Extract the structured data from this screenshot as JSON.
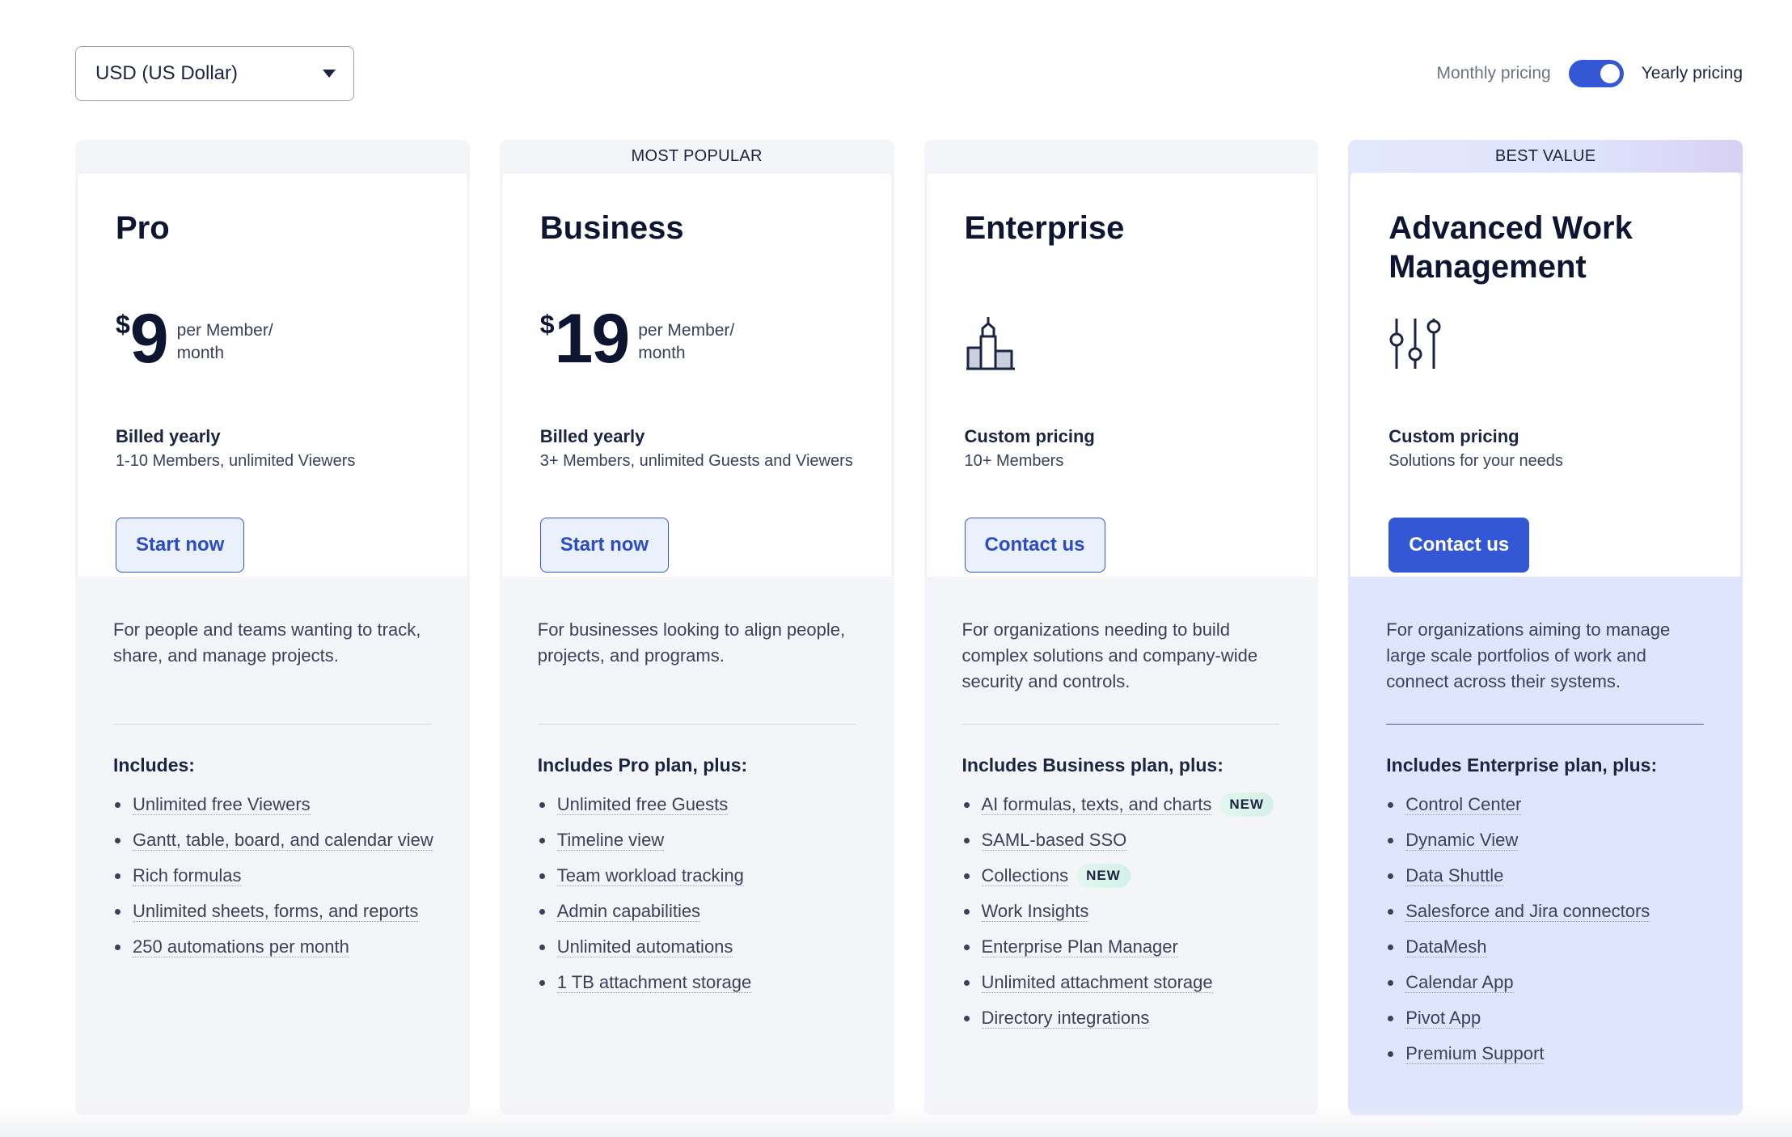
{
  "currency_select": {
    "value": "USD (US Dollar)"
  },
  "billing_toggle": {
    "monthly_label": "Monthly pricing",
    "yearly_label": "Yearly pricing",
    "selected": "Yearly pricing"
  },
  "plans": [
    {
      "banner": "",
      "name": "Pro",
      "price": {
        "currency_symbol": "$",
        "amount": "9",
        "unit": "per Member/ month"
      },
      "billing": "Billed yearly",
      "billing_sub": "1-10 Members, unlimited Viewers",
      "cta": "Start now",
      "description": "For people and teams wanting to track, share, and manage projects.",
      "includes_title": "Includes:",
      "features": [
        {
          "text": "Unlimited free Viewers",
          "badge": ""
        },
        {
          "text": "Gantt, table, board, and calendar view",
          "badge": ""
        },
        {
          "text": "Rich formulas",
          "badge": ""
        },
        {
          "text": "Unlimited sheets, forms, and reports",
          "badge": ""
        },
        {
          "text": "250 automations per month",
          "badge": ""
        }
      ]
    },
    {
      "banner": "MOST POPULAR",
      "name": "Business",
      "price": {
        "currency_symbol": "$",
        "amount": "19",
        "unit": "per Member/ month"
      },
      "billing": "Billed yearly",
      "billing_sub": "3+ Members, unlimited Guests and Viewers",
      "cta": "Start now",
      "description": "For businesses looking to align people, projects, and programs.",
      "includes_title": "Includes Pro plan, plus:",
      "features": [
        {
          "text": "Unlimited free Guests",
          "badge": ""
        },
        {
          "text": "Timeline view",
          "badge": ""
        },
        {
          "text": "Team workload tracking",
          "badge": ""
        },
        {
          "text": "Admin capabilities",
          "badge": ""
        },
        {
          "text": "Unlimited automations",
          "badge": ""
        },
        {
          "text": "1 TB attachment storage",
          "badge": ""
        }
      ]
    },
    {
      "banner": "",
      "name": "Enterprise",
      "icon": "building-icon",
      "billing": "Custom pricing",
      "billing_sub": "10+ Members",
      "cta": "Contact us",
      "description": "For organizations needing to build complex solutions and company-wide security and controls.",
      "includes_title": "Includes Business plan, plus:",
      "features": [
        {
          "text": "AI formulas, texts, and charts",
          "badge": "NEW"
        },
        {
          "text": "SAML-based SSO",
          "badge": ""
        },
        {
          "text": "Collections",
          "badge": "NEW"
        },
        {
          "text": "Work Insights",
          "badge": ""
        },
        {
          "text": "Enterprise Plan Manager",
          "badge": ""
        },
        {
          "text": "Unlimited attachment storage",
          "badge": ""
        },
        {
          "text": "Directory integrations",
          "badge": ""
        }
      ]
    },
    {
      "banner": "BEST VALUE",
      "name": "Advanced Work Management",
      "icon": "sliders-icon",
      "billing": "Custom pricing",
      "billing_sub": "Solutions for your needs",
      "cta": "Contact us",
      "description": "For organizations aiming to manage large scale portfolios of work and connect across their systems.",
      "includes_title": "Includes Enterprise plan, plus:",
      "features": [
        {
          "text": "Control Center",
          "badge": ""
        },
        {
          "text": "Dynamic View",
          "badge": ""
        },
        {
          "text": "Data Shuttle",
          "badge": ""
        },
        {
          "text": "Salesforce and Jira connectors",
          "badge": ""
        },
        {
          "text": "DataMesh",
          "badge": ""
        },
        {
          "text": "Calendar App",
          "badge": ""
        },
        {
          "text": "Pivot App",
          "badge": ""
        },
        {
          "text": "Premium Support",
          "badge": ""
        }
      ]
    }
  ],
  "colors": {
    "accent": "#3457d5",
    "card_bg": "#f4f5f9",
    "featured_bg": "#dfe5fd",
    "text": "#1b2440"
  }
}
